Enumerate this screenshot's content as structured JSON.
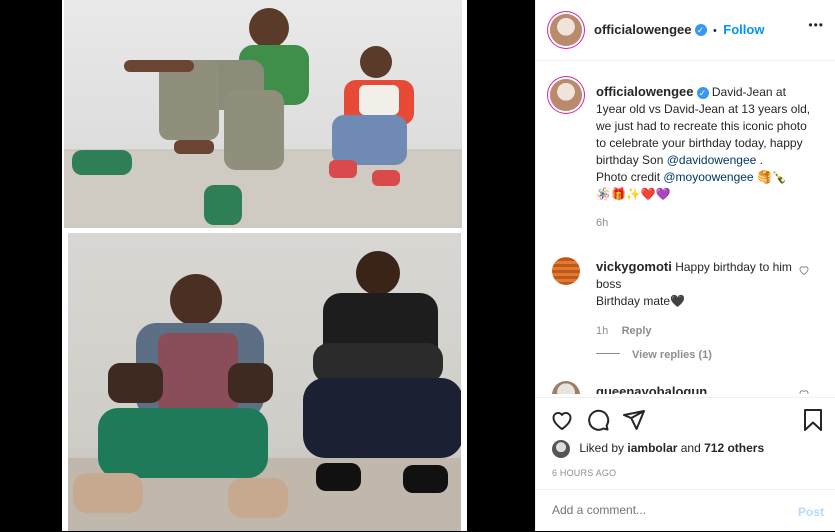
{
  "post": {
    "username": "officialowengee",
    "follow_label": "Follow",
    "dot": "•",
    "more_label": "•••"
  },
  "caption": {
    "username": "officialowengee",
    "text_1": "David-Jean at 1year old vs David-Jean at 13 years old, we just had to recreate this iconic photo to celebrate your birthday today, happy birthday Son ",
    "mention_1": "@davidowengee",
    "text_2": " .",
    "text_3": "Photo credit ",
    "mention_2": "@moyoowengee",
    "emoji_1": "🥞🍾",
    "emoji_2": "🪅🎁✨❤️💜",
    "time": "6h"
  },
  "comments": [
    {
      "username": "vickygomoti",
      "text": "Happy birthday to him boss",
      "text_2": "Birthday mate🖤",
      "time": "1h",
      "reply_label": "Reply",
      "view_replies": "View replies (1)"
    },
    {
      "username": "queenayobalogun"
    }
  ],
  "likes": {
    "prefix": "Liked by",
    "user": "iambolar",
    "and": "and",
    "others": "712 others"
  },
  "timestamp": "6 HOURS AGO",
  "add_comment": {
    "placeholder": "Add a comment...",
    "post_label": "Post"
  },
  "colors": {
    "accent": "#0095f6",
    "verified": "#3897f0"
  },
  "icons": {
    "like": "heart-icon",
    "comment": "comment-icon",
    "share": "share-icon",
    "save": "bookmark-icon",
    "more": "more-icon",
    "comment_like": "small-heart-icon"
  }
}
